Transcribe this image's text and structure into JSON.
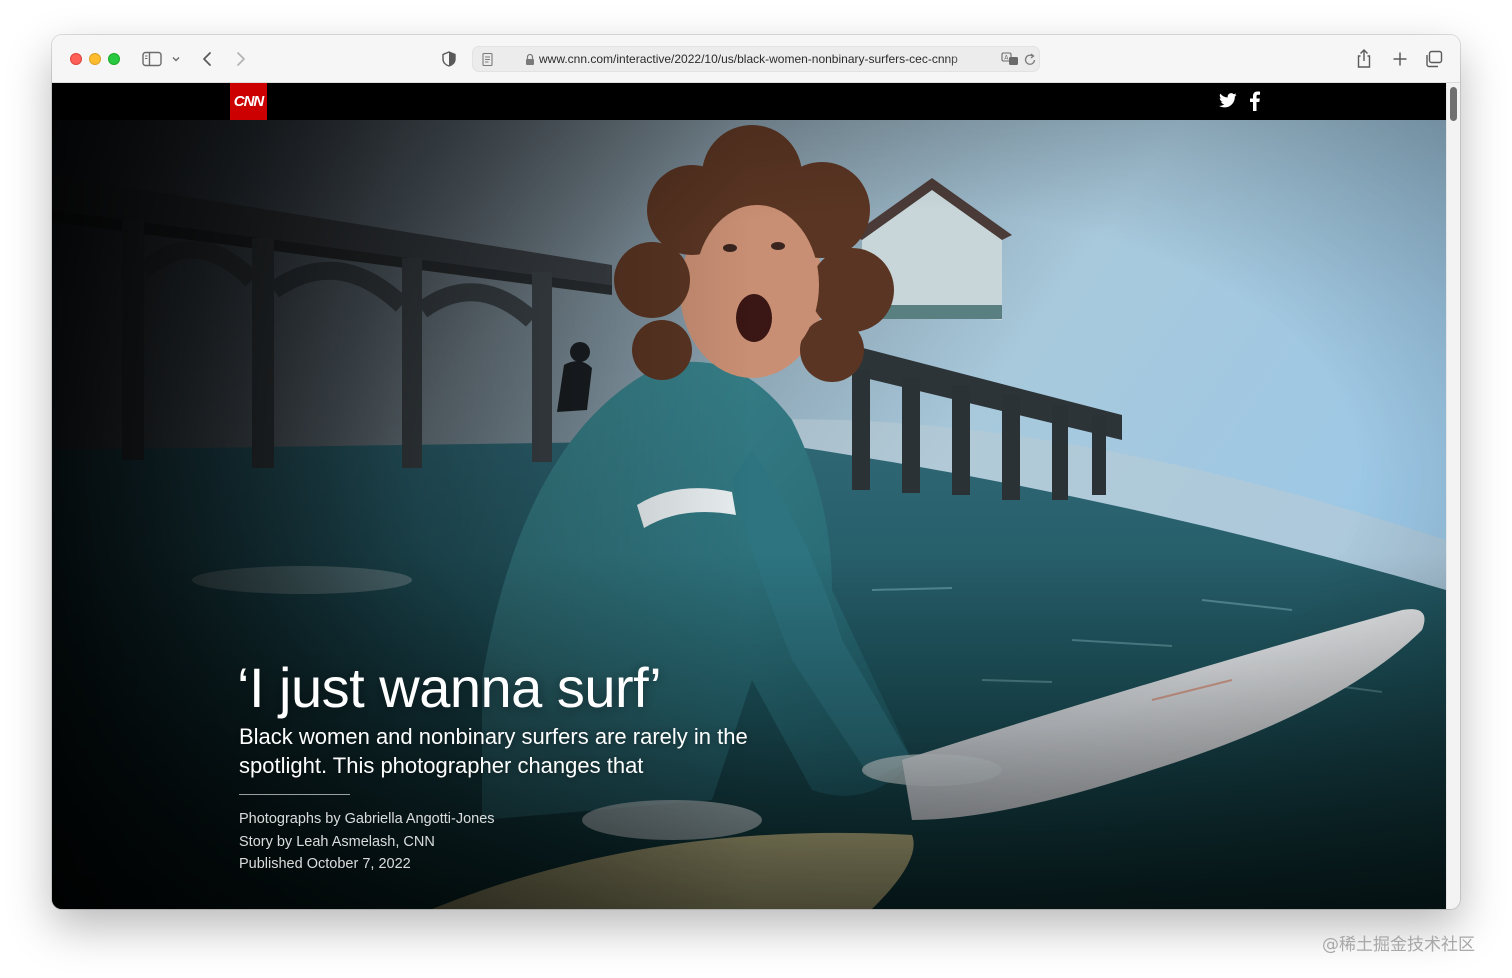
{
  "browser": {
    "url": "www.cnn.com/interactive/2022/10/us/black-women-nonbinary-surfers-cec-cnnp",
    "icons": [
      "sidebar-icon",
      "chevron-down-icon",
      "back-icon",
      "forward-icon",
      "shield-icon",
      "reader-icon",
      "lock-icon",
      "translate-icon",
      "reload-icon",
      "share-icon",
      "new-tab-icon",
      "tab-overview-icon"
    ]
  },
  "site": {
    "logo_text": "CNN",
    "logo_color": "#cc0000",
    "social_icons": [
      "twitter-icon",
      "facebook-icon"
    ]
  },
  "article": {
    "headline": "‘I just wanna surf’",
    "subhead": "Black women and nonbinary surfers are rarely in the spotlight. This photographer changes that",
    "credits": {
      "photographs": "Photographs by Gabriella Angotti-Jones",
      "story": "Story by Leah Asmelash, CNN",
      "published": "Published October 7, 2022"
    }
  },
  "watermark": "@稀土掘金技术社区"
}
